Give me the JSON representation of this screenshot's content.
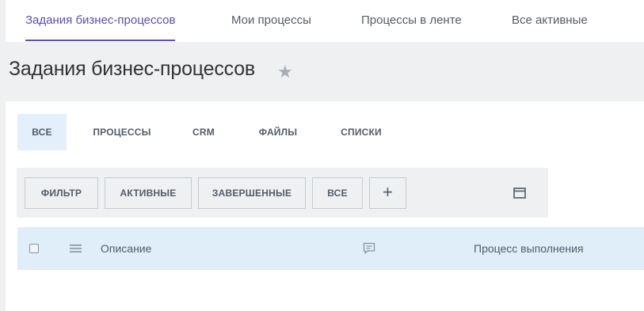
{
  "nav": {
    "tabs": [
      {
        "label": "Задания бизнес-процессов",
        "active": true
      },
      {
        "label": "Мои процессы"
      },
      {
        "label": "Процессы в ленте"
      },
      {
        "label": "Все активные"
      }
    ]
  },
  "page": {
    "title": "Задания бизнес-процессов",
    "star_icon": "star-icon"
  },
  "subtabs": [
    {
      "label": "ВСЕ",
      "active": true
    },
    {
      "label": "ПРОЦЕССЫ"
    },
    {
      "label": "CRM"
    },
    {
      "label": "ФАЙЛЫ"
    },
    {
      "label": "СПИСКИ"
    }
  ],
  "filters": {
    "buttons": [
      "ФИЛЬТР",
      "АКТИВНЫЕ",
      "ЗАВЕРШЕННЫЕ",
      "ВСЕ"
    ],
    "add_label": "+",
    "settings_icon": "window-settings-icon"
  },
  "table": {
    "columns": {
      "description": "Описание",
      "comments_icon": "comment-icon",
      "progress": "Процесс выполнения"
    }
  },
  "colors": {
    "accent": "#5b4eb6",
    "header_bg": "#dfeef9",
    "active_subtab_bg": "#e3f0fb",
    "page_bg": "#eef0f2"
  }
}
